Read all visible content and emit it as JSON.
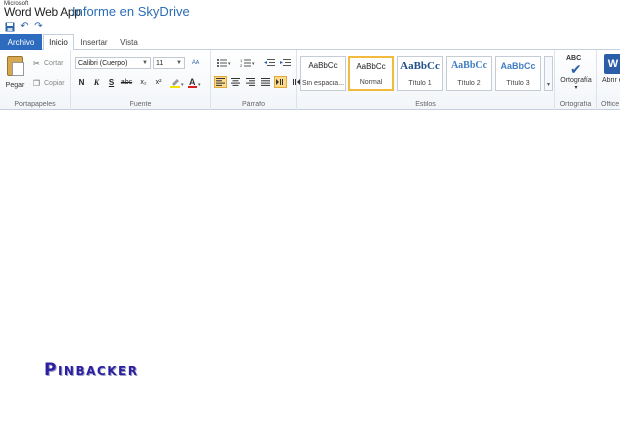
{
  "app": {
    "brand_small": "Microsoft",
    "brand_main": "Word Web App",
    "doc_title": "Informe  en  SkyDrive"
  },
  "quick_access": {
    "save_icon": "save-icon",
    "undo_icon": "undo-icon",
    "redo_icon": "redo-icon"
  },
  "tabs": {
    "file": "Archivo",
    "items": [
      "Inicio",
      "Insertar",
      "Vista"
    ],
    "active": "Inicio"
  },
  "clipboard": {
    "paste": "Pegar",
    "cut": "Cortar",
    "copy": "Copiar",
    "label": "Portapapeles"
  },
  "font": {
    "family": "Calibri (Cuerpo)",
    "size": "11",
    "bold": "N",
    "italic": "K",
    "underline": "S",
    "strike": "abc",
    "subscript": "x₂",
    "superscript": "x²",
    "label": "Fuente"
  },
  "paragraph": {
    "label": "Párrafo"
  },
  "styles": {
    "items": [
      {
        "sample": "AaBbCc",
        "name": "Sin espacia..."
      },
      {
        "sample": "AaBbCc",
        "name": "Normal"
      },
      {
        "sample": "AaBbCc",
        "name": "Título 1"
      },
      {
        "sample": "AaBbCc",
        "name": "Título 2"
      },
      {
        "sample": "AaBbCc",
        "name": "Título 3"
      }
    ],
    "selected": "Normal",
    "label": "Estilos"
  },
  "spelling": {
    "icon_text": "ABC",
    "button": "Ortografía",
    "label": "Ortografía"
  },
  "office": {
    "button": "Abrir en Word",
    "label": "Office"
  },
  "watermark": "Pinbacker",
  "colors": {
    "file_tab": "#2d6bbf",
    "doc_title": "#2a6db5",
    "selected_style": "#f1bb3d",
    "watermark": "#2d1fa0"
  }
}
